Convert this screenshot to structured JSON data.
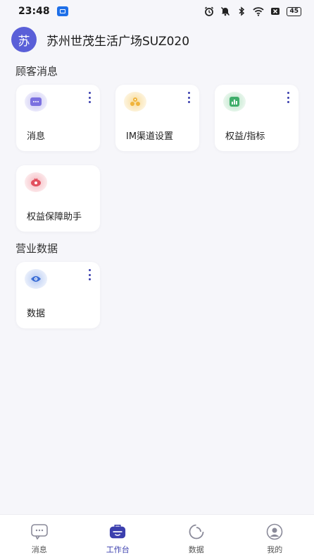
{
  "status_bar": {
    "time": "23:48",
    "battery": "45"
  },
  "header": {
    "avatar_text": "苏",
    "store_name": "苏州世茂生活广场SUZ020"
  },
  "sections": {
    "customer_messages": {
      "title": "顾客消息",
      "cards": [
        {
          "label": "消息",
          "icon": "chat-icon",
          "color": "#7b70e0"
        },
        {
          "label": "IM渠道设置",
          "icon": "channel-icon",
          "color": "#f0b43c"
        },
        {
          "label": "权益/指标",
          "icon": "chart-icon",
          "color": "#3fae6a"
        },
        {
          "label": "权益保障助手",
          "icon": "shield-icon",
          "color": "#e2505e"
        }
      ]
    },
    "business_data": {
      "title": "营业数据",
      "cards": [
        {
          "label": "数据",
          "icon": "eye-icon",
          "color": "#3d6fd6"
        }
      ]
    }
  },
  "tabbar": {
    "items": [
      {
        "label": "消息",
        "icon": "message-icon"
      },
      {
        "label": "工作台",
        "icon": "workbench-icon",
        "active": true
      },
      {
        "label": "数据",
        "icon": "data-icon"
      },
      {
        "label": "我的",
        "icon": "profile-icon"
      }
    ]
  },
  "colors": {
    "accent": "#3b3fae",
    "avatar_bg": "#5a5fd8",
    "page_bg": "#f6f6fa"
  }
}
